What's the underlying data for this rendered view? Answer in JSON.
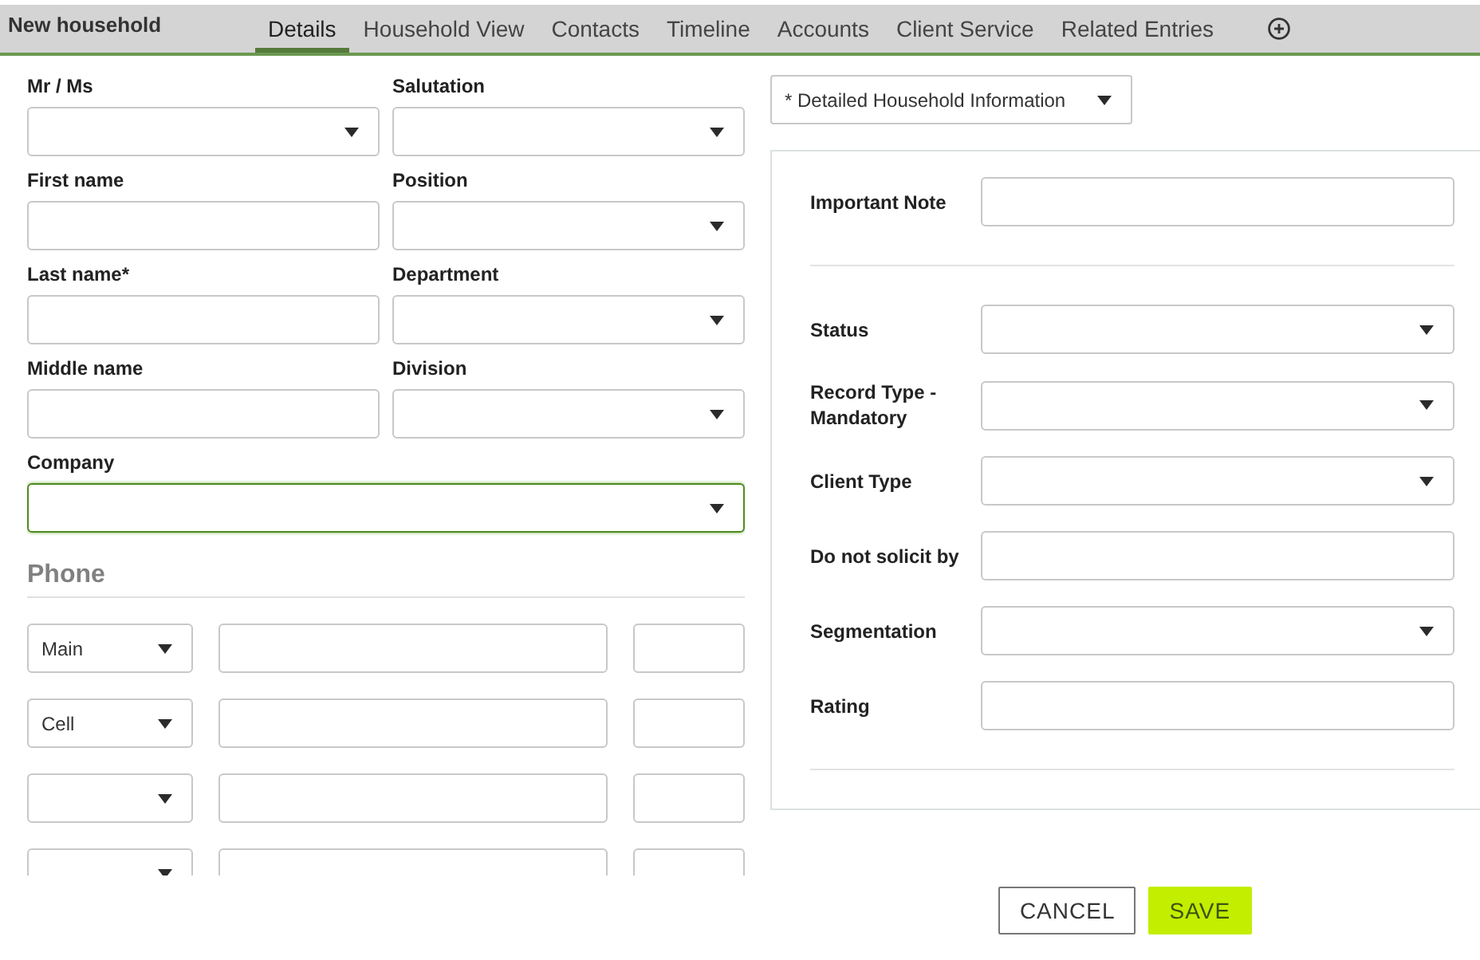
{
  "header": {
    "title": "New household"
  },
  "tabs": [
    {
      "label": "Details",
      "selected": true
    },
    {
      "label": "Household View",
      "selected": false
    },
    {
      "label": "Contacts",
      "selected": false
    },
    {
      "label": "Timeline",
      "selected": false
    },
    {
      "label": "Accounts",
      "selected": false
    },
    {
      "label": "Client Service",
      "selected": false
    },
    {
      "label": "Related Entries",
      "selected": false
    }
  ],
  "left_form": {
    "rows": [
      {
        "fields": [
          {
            "label": "Mr / Ms",
            "kind": "select",
            "focused": false
          },
          {
            "label": "Salutation",
            "kind": "select",
            "focused": false
          }
        ]
      },
      {
        "fields": [
          {
            "label": "First name",
            "kind": "text",
            "focused": false
          },
          {
            "label": "Position",
            "kind": "select",
            "focused": false
          }
        ]
      },
      {
        "fields": [
          {
            "label": "Last name*",
            "kind": "text",
            "focused": false
          },
          {
            "label": "Department",
            "kind": "select",
            "focused": false
          }
        ]
      },
      {
        "fields": [
          {
            "label": "Middle name",
            "kind": "text",
            "focused": false
          },
          {
            "label": "Division",
            "kind": "select",
            "focused": false
          }
        ]
      },
      {
        "fields": [
          {
            "label": "Company",
            "kind": "select",
            "focused": true
          }
        ]
      }
    ]
  },
  "phone": {
    "heading": "Phone",
    "rows": [
      {
        "type": "Main"
      },
      {
        "type": "Cell"
      },
      {},
      {}
    ]
  },
  "section_dropdown": {
    "value": "* Detailed Household Information"
  },
  "detail_panel": {
    "groups": [
      {
        "fields": [
          {
            "label": "Important Note",
            "kind": "text"
          }
        ]
      },
      {
        "fields": [
          {
            "label": "Status",
            "kind": "select"
          },
          {
            "label": "Record Type - Mandatory",
            "kind": "select"
          },
          {
            "label": "Client Type",
            "kind": "select"
          },
          {
            "label": "Do not solicit by",
            "kind": "text"
          },
          {
            "label": "Segmentation",
            "kind": "select"
          },
          {
            "label": "Rating",
            "kind": "text"
          }
        ]
      }
    ]
  },
  "buttons": [
    {
      "label": "CANCEL",
      "kind": "secondary"
    },
    {
      "label": "SAVE",
      "kind": "primary"
    }
  ]
}
